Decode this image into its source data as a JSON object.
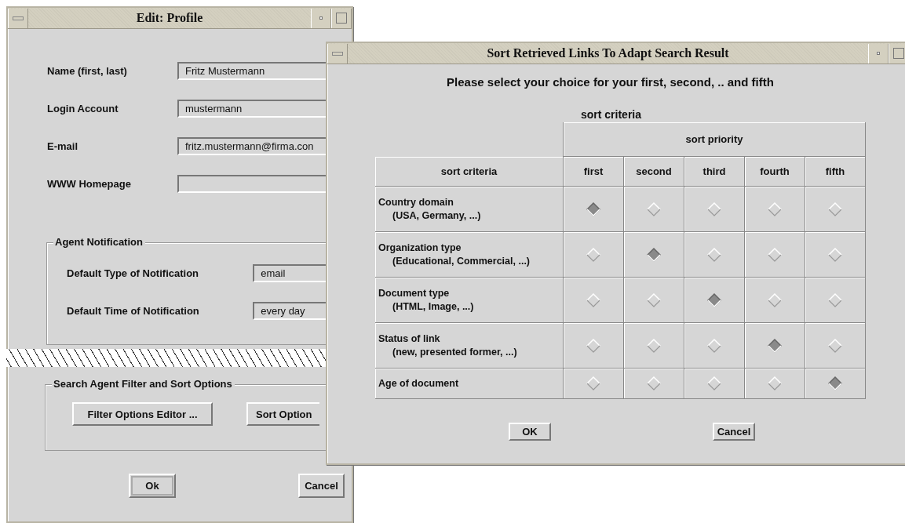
{
  "profile_window": {
    "title": "Edit: Profile",
    "fields": [
      {
        "label": "Name (first, last)",
        "value": "Fritz Mustermann"
      },
      {
        "label": "Login Account",
        "value": "mustermann"
      },
      {
        "label": "E-mail",
        "value": "fritz.mustermann@firma.con"
      },
      {
        "label": "WWW Homepage"
      }
    ],
    "agent_notification": {
      "legend": "Agent Notification",
      "rows": [
        {
          "label": "Default Type of Notification",
          "value": "email"
        },
        {
          "label": "Default Time of Notification",
          "value": "every day"
        }
      ]
    },
    "filter_group": {
      "legend": "Search Agent Filter and Sort Options",
      "buttons": [
        "Filter Options Editor ...",
        "Sort Option"
      ]
    },
    "buttons": [
      "Ok",
      "Cancel"
    ]
  },
  "sort_window": {
    "title": "Sort Retrieved Links To Adapt Search Result",
    "instruction": "Please select your choice for your first, second, .. and fifth",
    "caption": "sort criteria",
    "table": {
      "group_header": "sort priority",
      "criteria_header": "sort criteria",
      "columns": [
        "first",
        "second",
        "third",
        "fourth",
        "fifth"
      ],
      "rows": [
        {
          "label": "Country domain",
          "detail": "(USA, Germany, ...)",
          "choices": [
            {
              "selected": true
            },
            {
              "selected": false
            },
            {
              "selected": false
            },
            {
              "selected": false
            },
            {
              "selected": false
            }
          ]
        },
        {
          "label": "Organization type",
          "detail": "(Educational, Commercial, ...)",
          "choices": [
            {
              "selected": false
            },
            {
              "selected": true
            },
            {
              "selected": false
            },
            {
              "selected": false
            },
            {
              "selected": false
            }
          ]
        },
        {
          "label": "Document type",
          "detail": "(HTML, Image, ...)",
          "choices": [
            {
              "selected": false
            },
            {
              "selected": false
            },
            {
              "selected": true
            },
            {
              "selected": false
            },
            {
              "selected": false
            }
          ]
        },
        {
          "label": "Status of link",
          "detail": "(new, presented former, ...)",
          "choices": [
            {
              "selected": false
            },
            {
              "selected": false
            },
            {
              "selected": false
            },
            {
              "selected": true
            },
            {
              "selected": false
            }
          ]
        },
        {
          "label": "Age of document",
          "choices": [
            {
              "selected": false
            },
            {
              "selected": false
            },
            {
              "selected": false
            },
            {
              "selected": false
            },
            {
              "selected": true
            }
          ]
        }
      ]
    },
    "buttons": [
      "OK",
      "Cancel"
    ]
  }
}
